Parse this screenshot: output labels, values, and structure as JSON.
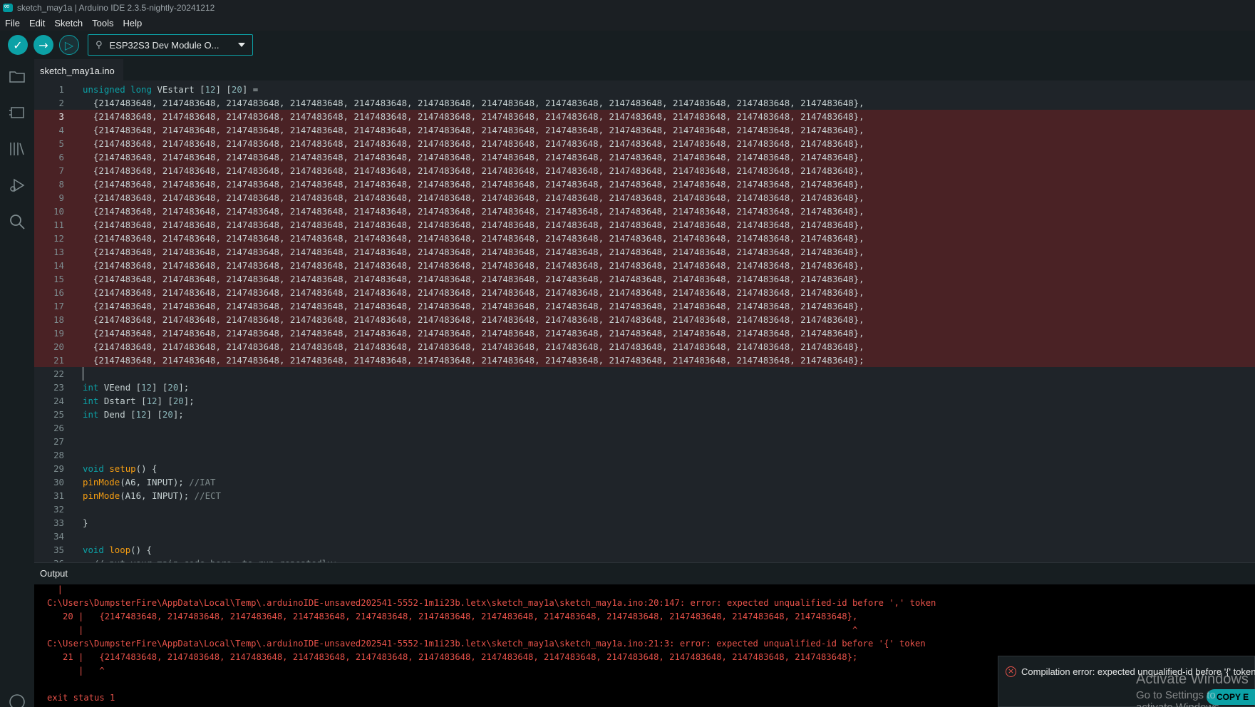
{
  "window": {
    "title": "sketch_may1a | Arduino IDE 2.3.5-nightly-20241212"
  },
  "menu": [
    "File",
    "Edit",
    "Sketch",
    "Tools",
    "Help"
  ],
  "toolbar": {
    "verify_icon": "check-icon",
    "upload_icon": "arrow-right-icon",
    "debug_icon": "debug-icon",
    "board_label": "ESP32S3 Dev Module O..."
  },
  "sidebar": [
    "folder-icon",
    "board-manager-icon",
    "library-icon",
    "debug-icon",
    "search-icon"
  ],
  "tabs": [
    {
      "label": "sketch_may1a.ino"
    }
  ],
  "editor": {
    "highlight_color": "#4a2225",
    "row_text": "{2147483648, 2147483648, 2147483648, 2147483648, 2147483648, 2147483648, 2147483648, 2147483648, 2147483648, 2147483648, 2147483648, 2147483648}",
    "line1": "unsigned long VEstart [12] [20] =",
    "line23": "int VEend [12] [20];",
    "line24": "int Dstart [12] [20];",
    "line25": "int Dend [12] [20];",
    "line29": "void setup() {",
    "line30_code": "pinMode(A6, INPUT);",
    "line30_comment": "//IAT",
    "line31_code": "pinMode(A16, INPUT);",
    "line31_comment": "//ECT",
    "line33": "}",
    "line35": "void loop() {",
    "line36": "  // put your main code here, to run repeatedly:"
  },
  "output": {
    "tab_label": "Output",
    "lines": [
      "  |",
      "C:\\Users\\DumpsterFire\\AppData\\Local\\Temp\\.arduinoIDE-unsaved202541-5552-1m1i23b.letx\\sketch_may1a\\sketch_may1a.ino:20:147: error: expected unqualified-id before ',' token",
      "   20 |   {2147483648, 2147483648, 2147483648, 2147483648, 2147483648, 2147483648, 2147483648, 2147483648, 2147483648, 2147483648, 2147483648, 2147483648},",
      "      |                                                                                                                                                   ^",
      "C:\\Users\\DumpsterFire\\AppData\\Local\\Temp\\.arduinoIDE-unsaved202541-5552-1m1i23b.letx\\sketch_may1a\\sketch_may1a.ino:21:3: error: expected unqualified-id before '{' token",
      "   21 |   {2147483648, 2147483648, 2147483648, 2147483648, 2147483648, 2147483648, 2147483648, 2147483648, 2147483648, 2147483648, 2147483648, 2147483648};",
      "      |   ^",
      "",
      "exit status 1"
    ]
  },
  "toast": {
    "message": "Compilation error: expected unqualified-id before '{' token",
    "copy_label": "COPY E"
  },
  "watermark": {
    "title": "Activate Windows",
    "subtitle": "Go to Settings to activate Windows."
  }
}
